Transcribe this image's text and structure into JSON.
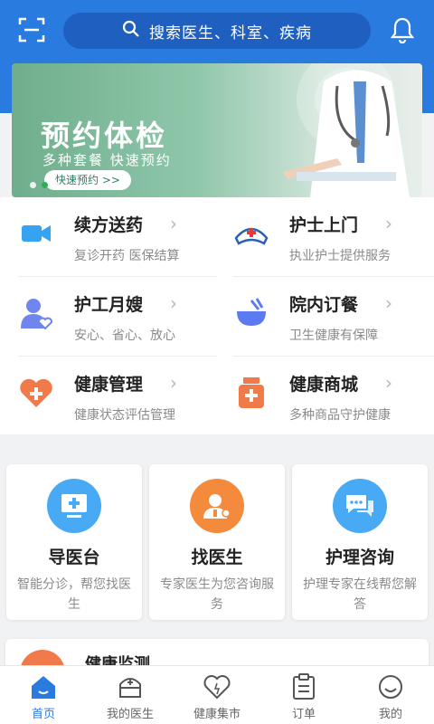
{
  "header": {
    "search_placeholder": "搜索医生、科室、疾病",
    "left_icon": "scan-icon",
    "right_icon": "bell-icon",
    "colors": {
      "header_bg": "#2a7be0",
      "search_bg": "#1f5fbf"
    }
  },
  "banner": {
    "title": "预约体检",
    "subtitle": "多种套餐 快速预约",
    "pill": "快速预约 >>",
    "active_index": 1,
    "count": 3
  },
  "services": [
    {
      "name": "续方送药",
      "desc": "复诊开药 医保结算",
      "icon": "video-camera-icon",
      "color": "#35a3f2"
    },
    {
      "name": "护士上门",
      "desc": "执业护士提供服务",
      "icon": "nurse-cap-icon",
      "color": "#2a7be0"
    },
    {
      "name": "护工月嫂",
      "desc": "安心、省心、放心",
      "icon": "caregiver-icon",
      "color": "#6f86f0"
    },
    {
      "name": "院内订餐",
      "desc": "卫生健康有保障",
      "icon": "bowl-icon",
      "color": "#5b7bf0"
    },
    {
      "name": "健康管理",
      "desc": "健康状态评估管理",
      "icon": "heart-plus-icon",
      "color": "#f07a4a"
    },
    {
      "name": "健康商城",
      "desc": "多种商品守护健康",
      "icon": "medicine-bottle-icon",
      "color": "#f07a4a"
    }
  ],
  "cards": [
    {
      "title": "导医台",
      "desc": "智能分诊，帮您找医生",
      "icon": "monitor-icon",
      "color": "#48a9f5"
    },
    {
      "title": "找医生",
      "desc": "专家医生为您咨询服务",
      "icon": "doctor-icon",
      "color": "#f48a3c"
    },
    {
      "title": "护理咨询",
      "desc": "护理专家在线帮您解答",
      "icon": "chat-icon",
      "color": "#48a9f5"
    }
  ],
  "monitor": {
    "title": "健康监测"
  },
  "tabs": [
    {
      "label": "首页",
      "icon": "home-icon",
      "active": true
    },
    {
      "label": "我的医生",
      "icon": "doctor-bag-icon",
      "active": false
    },
    {
      "label": "健康集市",
      "icon": "heart-icon",
      "active": false
    },
    {
      "label": "订单",
      "icon": "clipboard-icon",
      "active": false
    },
    {
      "label": "我的",
      "icon": "smile-icon",
      "active": false
    }
  ]
}
